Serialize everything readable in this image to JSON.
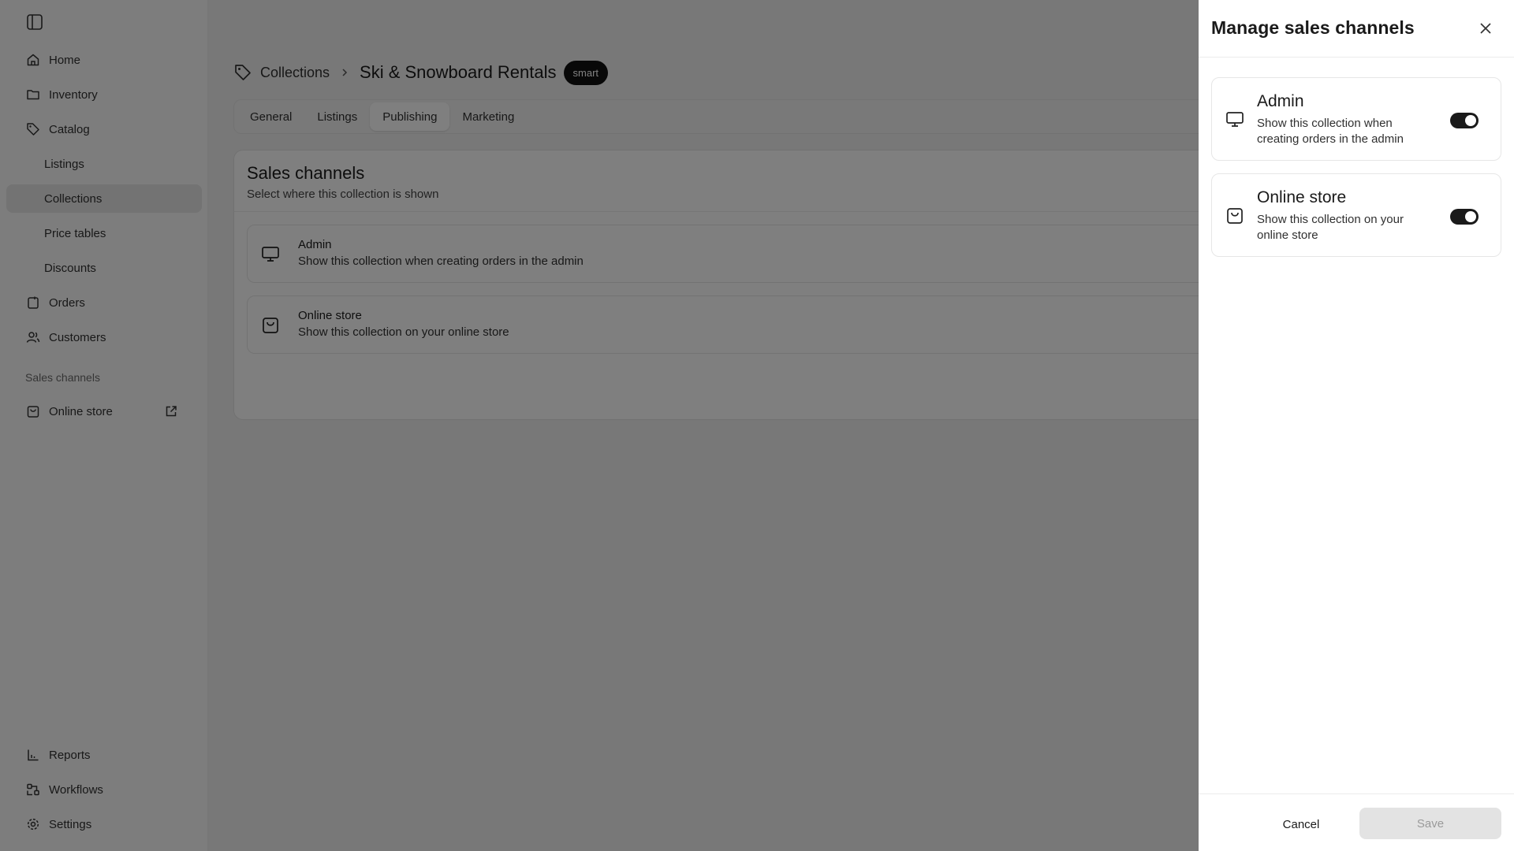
{
  "sidebar": {
    "items": [
      {
        "label": "Home",
        "icon": "home-icon"
      },
      {
        "label": "Inventory",
        "icon": "folder-icon"
      },
      {
        "label": "Catalog",
        "icon": "tag-icon"
      },
      {
        "label": "Listings"
      },
      {
        "label": "Collections",
        "active": true
      },
      {
        "label": "Price tables"
      },
      {
        "label": "Discounts"
      },
      {
        "label": "Orders",
        "icon": "orders-icon"
      },
      {
        "label": "Customers",
        "icon": "customers-icon"
      }
    ],
    "section_label": "Sales channels",
    "online_store": {
      "label": "Online store",
      "icon": "store-icon",
      "ext_icon": "external-link-icon"
    },
    "bottom": [
      {
        "label": "Reports",
        "icon": "reports-icon"
      },
      {
        "label": "Workflows",
        "icon": "workflows-icon"
      },
      {
        "label": "Settings",
        "icon": "gear-icon"
      }
    ]
  },
  "breadcrumb": {
    "parent": "Collections",
    "title": "Ski & Snowboard Rentals",
    "badge": "smart"
  },
  "tabs": [
    {
      "label": "General"
    },
    {
      "label": "Listings"
    },
    {
      "label": "Publishing",
      "active": true
    },
    {
      "label": "Marketing"
    }
  ],
  "card": {
    "title": "Sales channels",
    "subtitle": "Select where this collection is shown",
    "channels": [
      {
        "name": "Admin",
        "desc": "Show this collection when creating orders in the admin",
        "icon": "monitor-icon"
      },
      {
        "name": "Online store",
        "desc": "Show this collection on your online store",
        "icon": "store-icon"
      }
    ]
  },
  "drawer": {
    "title": "Manage sales channels",
    "channels": [
      {
        "name": "Admin",
        "desc": "Show this collection when creating orders in the admin",
        "icon": "monitor-icon",
        "enabled": true
      },
      {
        "name": "Online store",
        "desc": "Show this collection on your online store",
        "icon": "store-icon",
        "enabled": true
      }
    ],
    "cancel_label": "Cancel",
    "save_label": "Save"
  },
  "colors": {
    "overlay": "#000000",
    "toggle_on": "#1a1a1a",
    "badge_bg": "#111111"
  }
}
